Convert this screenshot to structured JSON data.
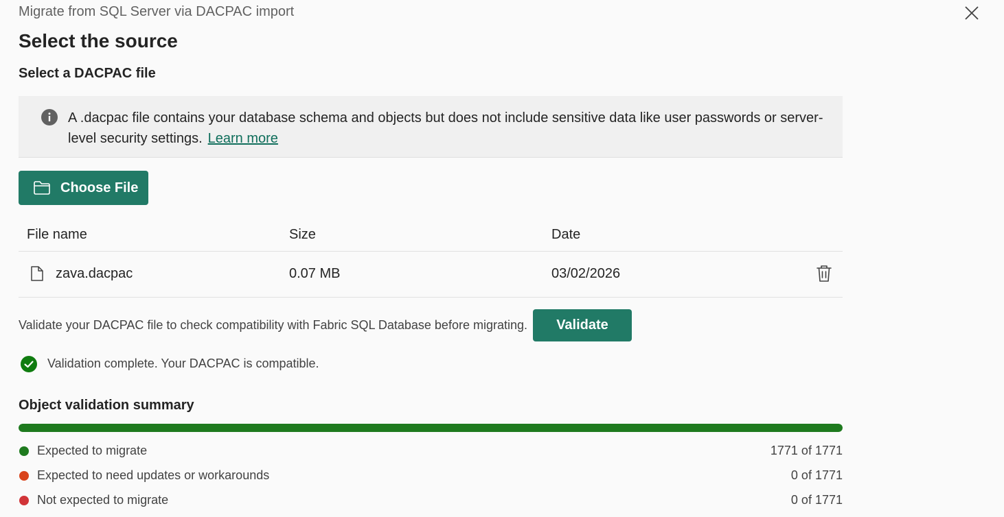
{
  "dialog": {
    "title": "Migrate from SQL Server via DACPAC import",
    "close_icon": "close-icon"
  },
  "page": {
    "title": "Select the source",
    "section_label": "Select a DACPAC file"
  },
  "info": {
    "icon": "info-icon",
    "text": "A .dacpac file contains your database schema and objects but does not include sensitive data like user passwords or server-level security settings.",
    "link_label": "Learn more"
  },
  "choose_file": {
    "icon": "folder-icon",
    "label": "Choose File",
    "color": "#217a66"
  },
  "table": {
    "columns": [
      "File name",
      "Size",
      "Date"
    ],
    "rows": [
      {
        "name": "zava.dacpac",
        "size": "0.07 MB",
        "date": "03/02/2026",
        "icon": "file-icon",
        "action_icon": "trash-icon"
      }
    ]
  },
  "validate": {
    "hint": "Validate your DACPAC file to check compatibility with Fabric SQL Database before migrating.",
    "button_label": "Validate",
    "status_icon": "check-circle-icon",
    "status_text": "Validation complete. Your DACPAC is compatible.",
    "status_color": "#107c10"
  },
  "summary": {
    "title": "Object validation summary",
    "progress_fraction": 1.0,
    "progress_color": "#1e7a1e",
    "items": [
      {
        "label": "Expected to migrate",
        "count": "1771 of 1771",
        "color": "#1e7a1e"
      },
      {
        "label": "Expected to need updates or workarounds",
        "count": "0 of 1771",
        "color": "#d9441c"
      },
      {
        "label": "Not expected to migrate",
        "count": "0 of 1771",
        "color": "#d13438"
      }
    ]
  }
}
